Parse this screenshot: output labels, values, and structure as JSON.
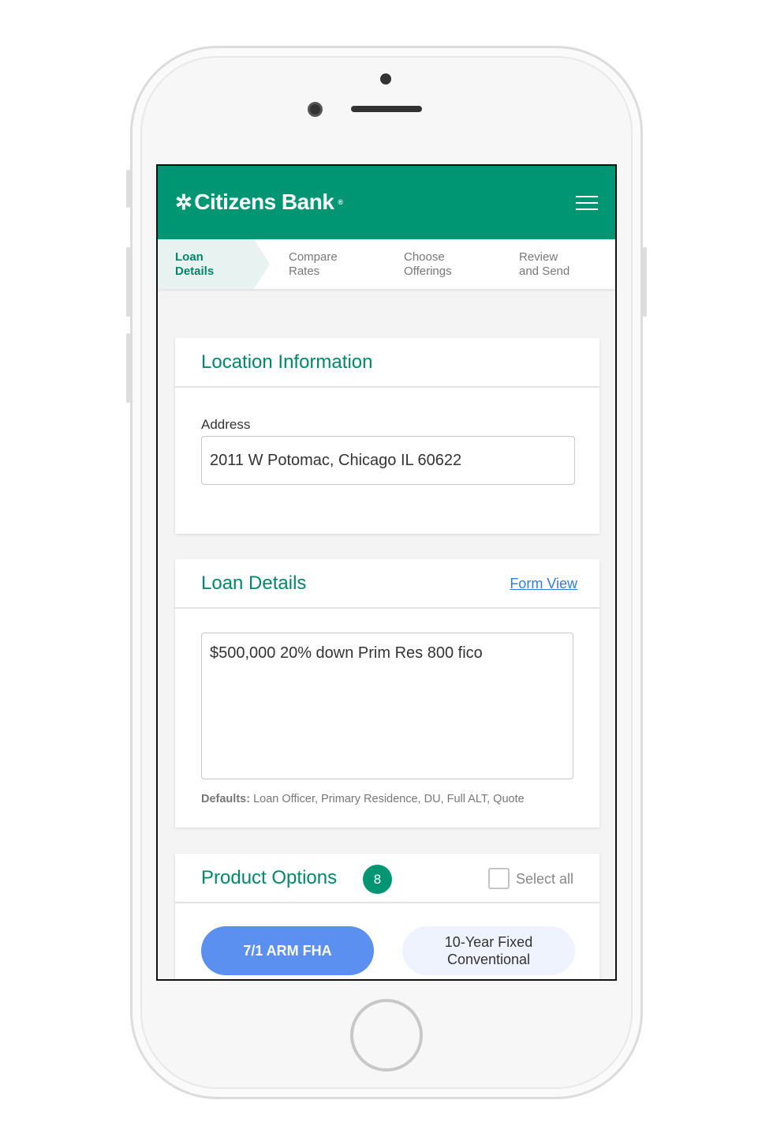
{
  "header": {
    "brand": "Citizens Bank",
    "brand_mark": "®",
    "menu_icon": "hamburger-icon",
    "color": "#009673"
  },
  "steps": [
    {
      "line1": "Loan",
      "line2": "Details",
      "active": true
    },
    {
      "line1": "Compare",
      "line2": "Rates"
    },
    {
      "line1": "Choose",
      "line2": "Offerings"
    },
    {
      "line1": "Review",
      "line2": "and Send"
    }
  ],
  "location": {
    "title": "Location Information",
    "address_label": "Address",
    "address_value": "2011 W Potomac, Chicago IL 60622"
  },
  "loan": {
    "title": "Loan Details",
    "form_view_link": "Form View",
    "description": "$500,000 20% down Prim Res 800 fico",
    "defaults_label": "Defaults:",
    "defaults_value": "Loan Officer, Primary Residence, DU, Full ALT, Quote"
  },
  "products": {
    "title": "Product Options",
    "count": "8",
    "select_all": "Select all",
    "options": [
      {
        "label": "7/1 ARM FHA",
        "selected": true
      },
      {
        "line1": "10-Year Fixed",
        "line2": "Conventional",
        "selected": false
      }
    ],
    "selected_color": "#5b8ff0"
  }
}
